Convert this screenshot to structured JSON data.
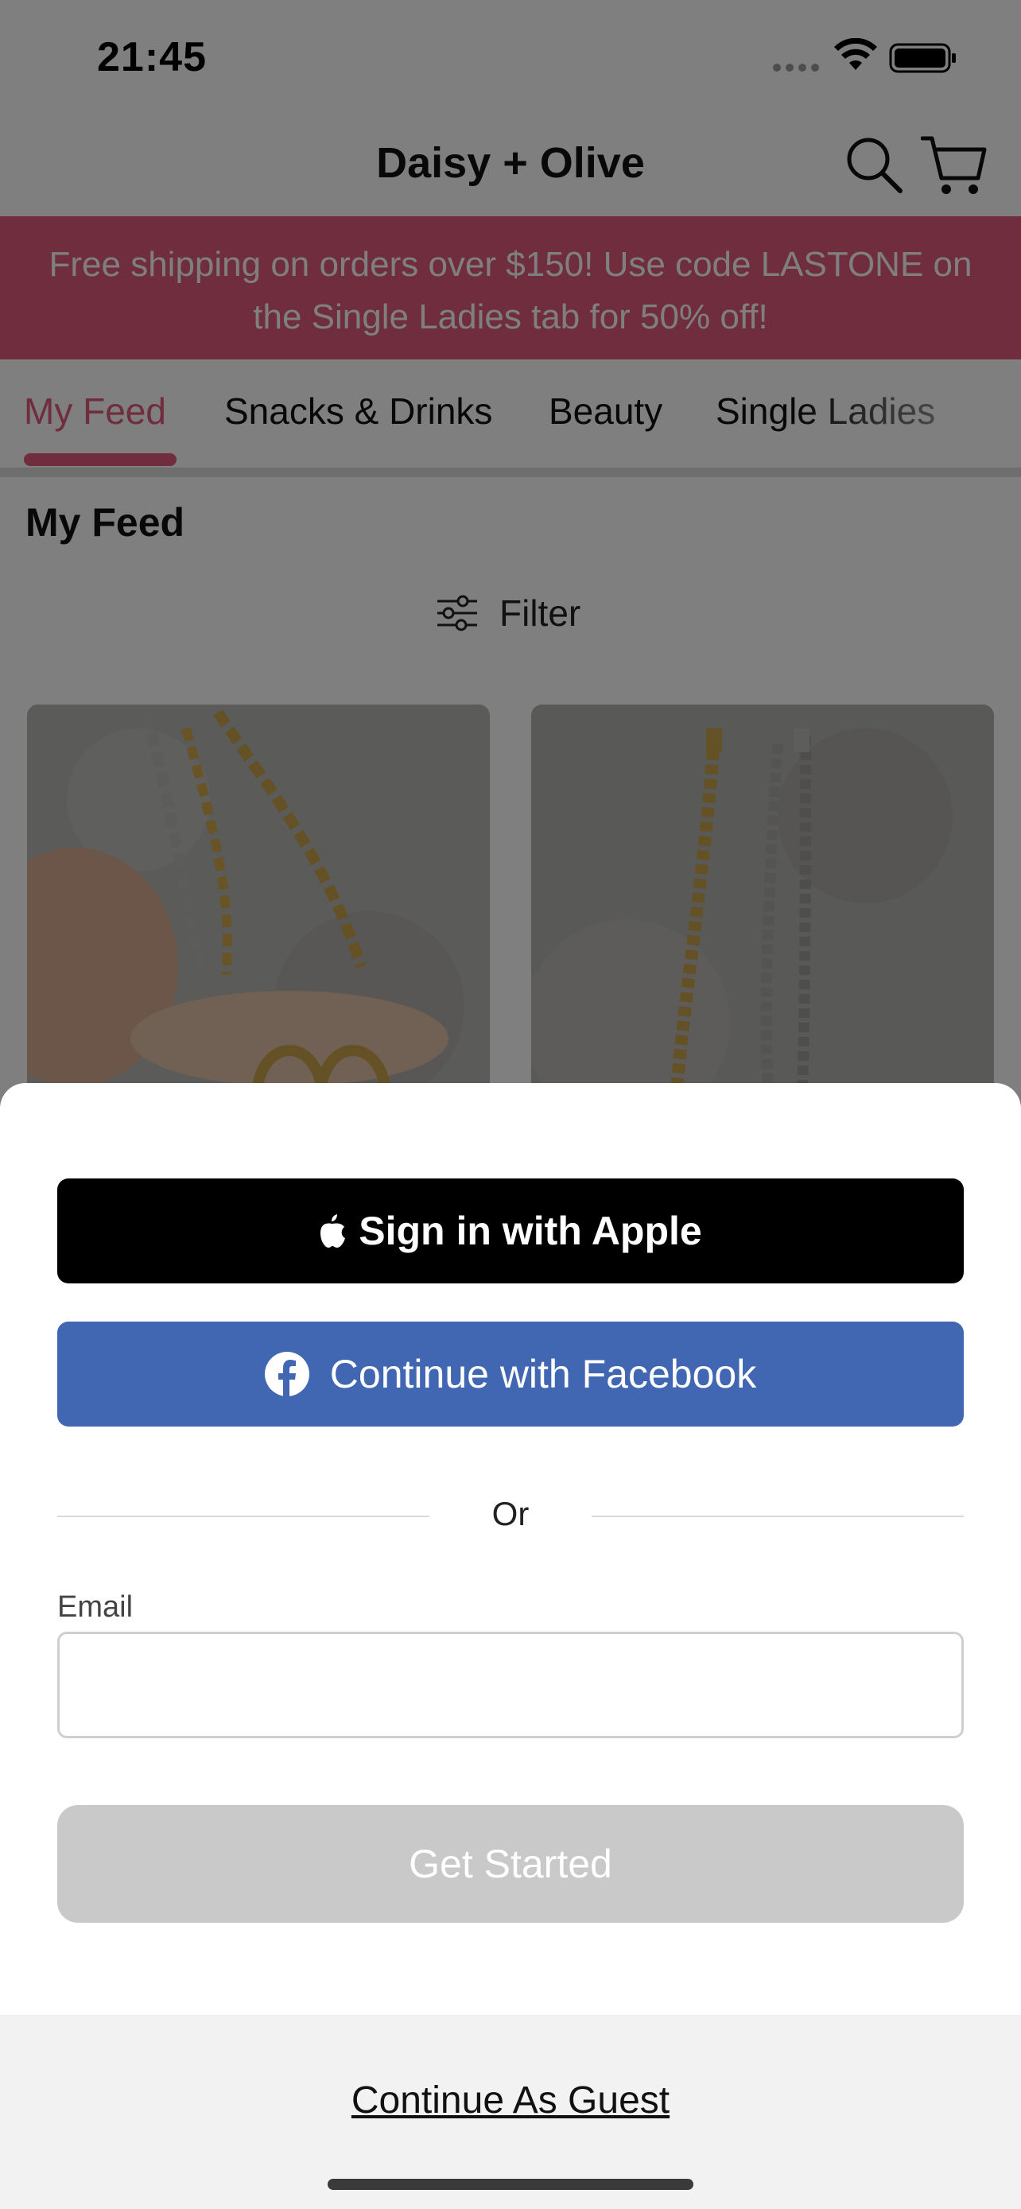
{
  "status_bar": {
    "time": "21:45"
  },
  "nav": {
    "title": "Daisy + Olive"
  },
  "promo": {
    "line1": "Free shipping on orders over $150! Use code LASTONE on",
    "line2": "the Single Ladies tab for 50% off!"
  },
  "tabs": [
    {
      "label": "My Feed",
      "active": true
    },
    {
      "label": "Snacks & Drinks",
      "active": false
    },
    {
      "label": "Beauty",
      "active": false
    },
    {
      "label": "Single Ladies",
      "active": false
    }
  ],
  "feed": {
    "heading": "My Feed",
    "filter_label": "Filter"
  },
  "auth": {
    "apple_label": "Sign in with Apple",
    "facebook_label": "Continue with Facebook",
    "divider_text": "Or",
    "email_label": "Email",
    "email_value": "",
    "get_started_label": "Get Started",
    "guest_label": "Continue As Guest"
  },
  "colors": {
    "brand_pink": "#e15a7b",
    "facebook_blue": "#4267b2",
    "disabled_gray": "#c9c9c9"
  }
}
